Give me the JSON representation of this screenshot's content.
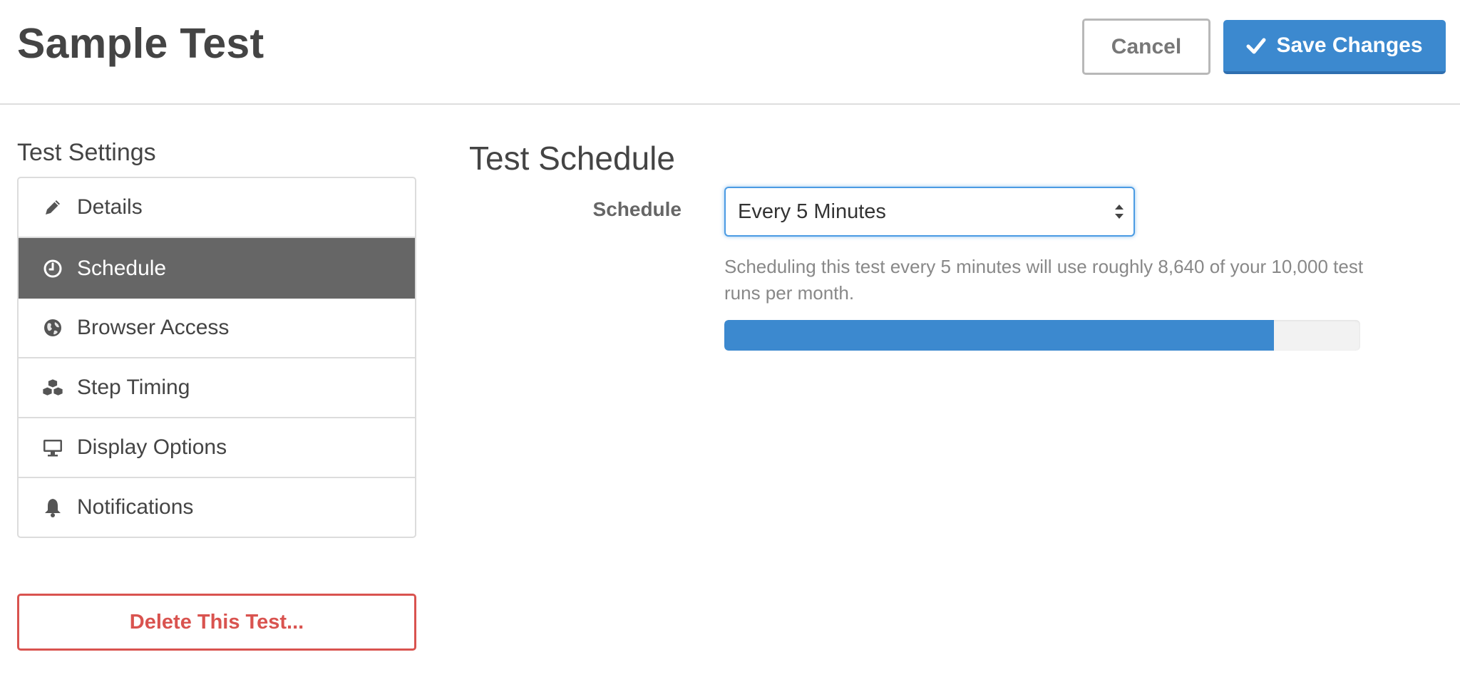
{
  "header": {
    "title": "Sample Test",
    "cancel_label": "Cancel",
    "save_label": "Save Changes",
    "save_icon": "check-icon"
  },
  "sidebar": {
    "heading": "Test Settings",
    "items": [
      {
        "label": "Details",
        "icon": "pencil-icon",
        "active": false
      },
      {
        "label": "Schedule",
        "icon": "clock-icon",
        "active": true
      },
      {
        "label": "Browser Access",
        "icon": "globe-icon",
        "active": false
      },
      {
        "label": "Step Timing",
        "icon": "cubes-icon",
        "active": false
      },
      {
        "label": "Display Options",
        "icon": "desktop-icon",
        "active": false
      },
      {
        "label": "Notifications",
        "icon": "bell-icon",
        "active": false
      }
    ],
    "delete_label": "Delete This Test..."
  },
  "main": {
    "section_title": "Test Schedule",
    "schedule_label": "Schedule",
    "schedule_value": "Every 5 Minutes",
    "help_text": "Scheduling this test every 5 minutes will use roughly 8,640 of your 10,000 test runs per month.",
    "usage_fraction": 0.864
  },
  "colors": {
    "accent": "#3c89cf",
    "active_nav": "#666666",
    "danger": "#d9534f"
  }
}
